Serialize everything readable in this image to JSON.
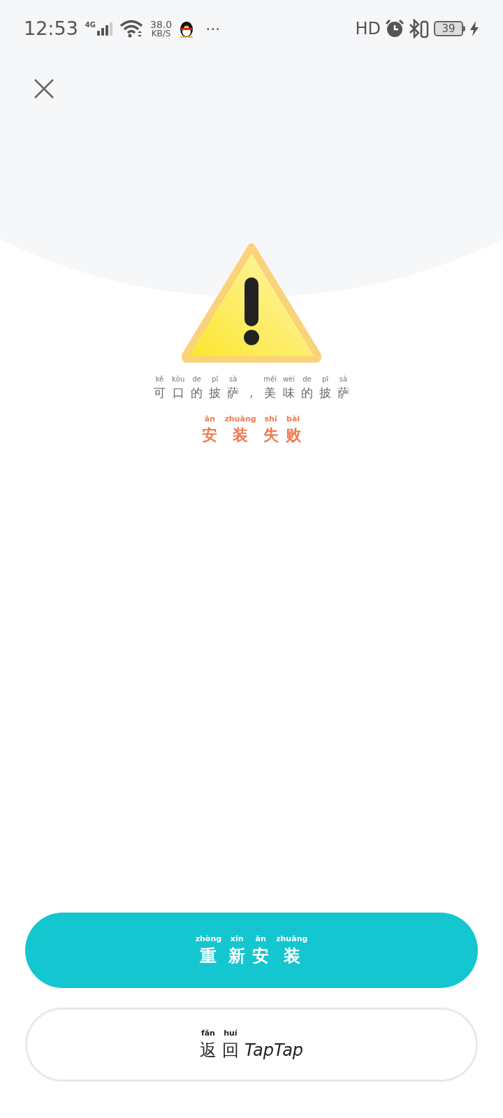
{
  "status_bar": {
    "time": "12:53",
    "network": "4G",
    "speed_value": "38.0",
    "speed_unit": "KB/S",
    "more": "···",
    "hd": "HD",
    "battery": "39"
  },
  "message": {
    "segments": [
      {
        "text": "可",
        "pinyin": "kě"
      },
      {
        "text": "口",
        "pinyin": "kǒu"
      },
      {
        "text": "的",
        "pinyin": "de"
      },
      {
        "text": "披",
        "pinyin": "pī"
      },
      {
        "text": "萨",
        "pinyin": "sà"
      },
      {
        "text": "，"
      },
      {
        "text": "美",
        "pinyin": "měi"
      },
      {
        "text": "味",
        "pinyin": "wèi"
      },
      {
        "text": "的",
        "pinyin": "de"
      },
      {
        "text": "披",
        "pinyin": "pī"
      },
      {
        "text": "萨",
        "pinyin": "sà"
      }
    ]
  },
  "title": {
    "segments": [
      {
        "text": "安",
        "pinyin": "ān"
      },
      {
        "text": "装",
        "pinyin": "zhuāng"
      },
      {
        "text": "失",
        "pinyin": "shī"
      },
      {
        "text": "败",
        "pinyin": "bài"
      }
    ]
  },
  "buttons": [
    {
      "kind": "primary",
      "segments": [
        {
          "text": "重",
          "pinyin": "zhòng"
        },
        {
          "text": "新",
          "pinyin": "xīn"
        },
        {
          "text": "安",
          "pinyin": "ān"
        },
        {
          "text": "装",
          "pinyin": "zhuāng"
        }
      ]
    },
    {
      "kind": "outline",
      "segments": [
        {
          "text": "返",
          "pinyin": "fǎn"
        },
        {
          "text": "回",
          "pinyin": "huí"
        },
        {
          "text": "TapTap"
        }
      ]
    }
  ]
}
